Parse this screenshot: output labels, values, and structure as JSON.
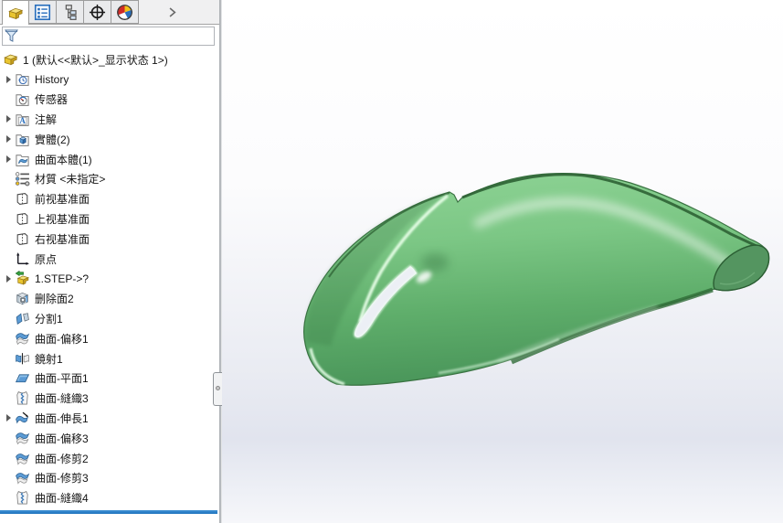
{
  "panel": {
    "tabs": [
      {
        "name": "featuremanager",
        "icon": "part-icon",
        "active": true
      },
      {
        "name": "propertymanager",
        "icon": "property-icon",
        "active": false
      },
      {
        "name": "configurationmanager",
        "icon": "config-icon",
        "active": false
      },
      {
        "name": "dimxpertmanager",
        "icon": "dimxpert-icon",
        "active": false
      },
      {
        "name": "displaymanager",
        "icon": "display-icon",
        "active": false
      }
    ],
    "overflow_arrow": "›",
    "filter": {
      "value": "",
      "icon": "filter-funnel-icon"
    }
  },
  "tree": {
    "root": {
      "icon": "part-icon",
      "label": "1 (默认<<默认>_显示状态 1>)"
    },
    "items": [
      {
        "icon": "folder-history",
        "label": "History",
        "expandable": true
      },
      {
        "icon": "folder-sensor",
        "label": "传感器",
        "expandable": false
      },
      {
        "icon": "folder-annotation",
        "label": "注解",
        "expandable": true
      },
      {
        "icon": "folder-solid",
        "label": "實體(2)",
        "expandable": true
      },
      {
        "icon": "folder-surface",
        "label": "曲面本體(1)",
        "expandable": true
      },
      {
        "icon": "material",
        "label": "材質 <未指定>",
        "expandable": false
      },
      {
        "icon": "plane",
        "label": "前视基准面",
        "expandable": false
      },
      {
        "icon": "plane",
        "label": "上视基准面",
        "expandable": false
      },
      {
        "icon": "plane",
        "label": "右视基准面",
        "expandable": false
      },
      {
        "icon": "origin",
        "label": "原点",
        "expandable": false
      },
      {
        "icon": "imported-part",
        "label": "1.STEP->?",
        "expandable": true
      },
      {
        "icon": "delete-face",
        "label": "删除面2",
        "expandable": false
      },
      {
        "icon": "split",
        "label": "分割1",
        "expandable": false
      },
      {
        "icon": "surface-offset",
        "label": "曲面-偏移1",
        "expandable": false
      },
      {
        "icon": "mirror",
        "label": "鏡射1",
        "expandable": false
      },
      {
        "icon": "surface-plane",
        "label": "曲面-平面1",
        "expandable": false
      },
      {
        "icon": "surface-knit",
        "label": "曲面-縫織3",
        "expandable": false
      },
      {
        "icon": "surface-extrude",
        "label": "曲面-伸長1",
        "expandable": true
      },
      {
        "icon": "surface-offset",
        "label": "曲面-偏移3",
        "expandable": false
      },
      {
        "icon": "surface-trim",
        "label": "曲面-修剪2",
        "expandable": false
      },
      {
        "icon": "surface-trim",
        "label": "曲面-修剪3",
        "expandable": false
      },
      {
        "icon": "surface-knit",
        "label": "曲面-縫織4",
        "expandable": false
      }
    ]
  },
  "rollback_bar_color": "#2079c8",
  "viewport": {
    "model_color_light": "#9fd9a2",
    "model_color_mid": "#6dbb76",
    "model_color_dark": "#2d6234",
    "background_top": "#ffffff",
    "background_bottom": "#e1e4ee"
  }
}
